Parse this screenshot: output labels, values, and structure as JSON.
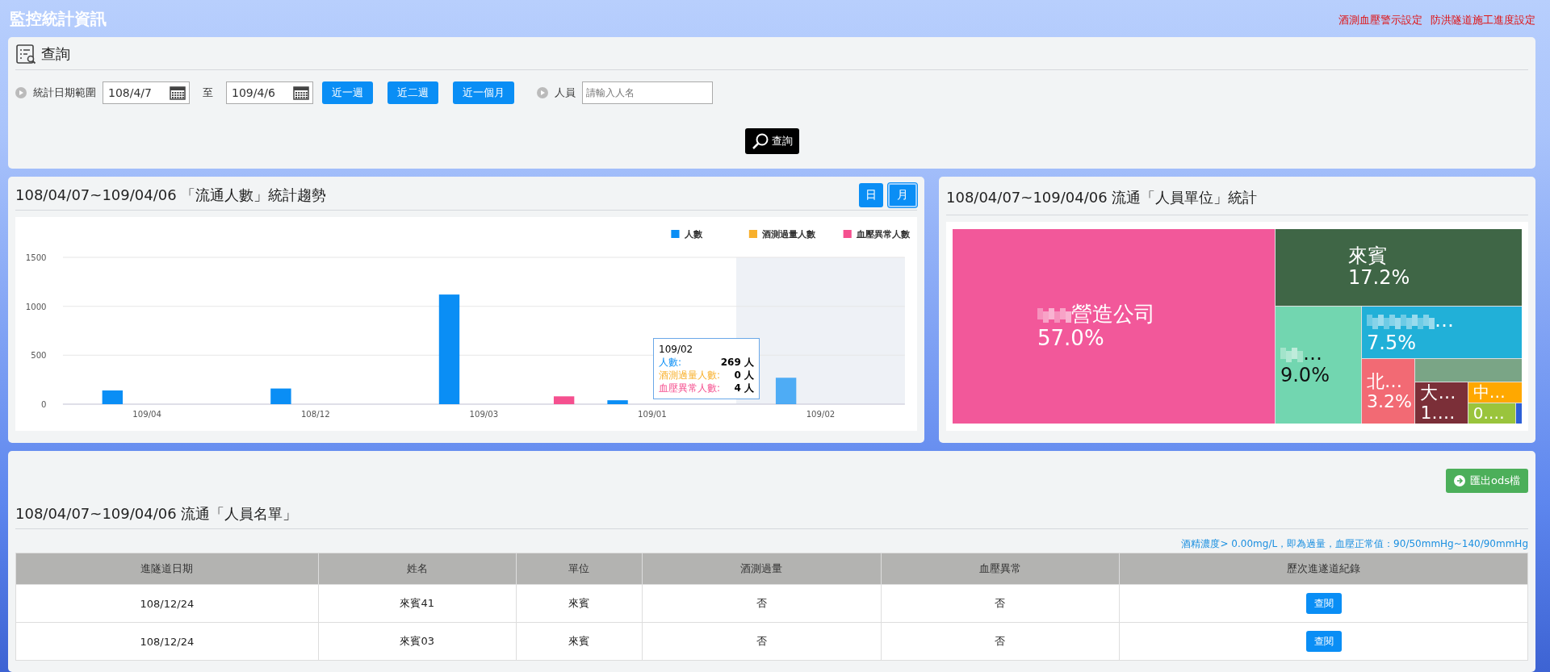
{
  "header": {
    "title": "監控統計資訊",
    "links": [
      "酒測血壓警示設定",
      "防洪隧道施工進度設定"
    ]
  },
  "query": {
    "title": "查詢",
    "date_label": "統計日期範圍",
    "date_from": "108/4/7",
    "to_label": "至",
    "date_to": "109/4/6",
    "quick_buttons": [
      "近一週",
      "近二週",
      "近一個月"
    ],
    "person_label": "人員",
    "person_placeholder": "請輸入人名",
    "submit": "查詢"
  },
  "trend": {
    "title": "108/04/07~109/04/06 「流通人數」統計趨勢",
    "modes": [
      {
        "label": "日",
        "selected": false
      },
      {
        "label": "月",
        "selected": true
      }
    ],
    "chart_data": {
      "type": "bar",
      "legend": "top-right",
      "categories": [
        "109/04",
        "108/12",
        "109/03",
        "109/01",
        "109/02"
      ],
      "ylim": [
        0,
        1500
      ],
      "yticks": [
        0,
        500,
        1000,
        1500
      ],
      "series": [
        {
          "name": "人數",
          "color": "#0a8ef5",
          "values": [
            140,
            160,
            1120,
            40,
            270
          ]
        },
        {
          "name": "酒測過量人數",
          "color": "#f8b02c",
          "values": [
            0,
            0,
            0,
            0,
            0
          ]
        },
        {
          "name": "血壓異常人數",
          "color": "#f5508f",
          "values": [
            0,
            0,
            80,
            0,
            null
          ]
        }
      ]
    },
    "tooltip": {
      "title": "109/02",
      "rows": [
        {
          "label": "人數:",
          "value": "269 人"
        },
        {
          "label": "酒測過量人數:",
          "value": "0 人"
        },
        {
          "label": "血壓異常人數:",
          "value": "4 人"
        }
      ]
    }
  },
  "units": {
    "title": "108/04/07~109/04/06 流通「人員單位」統計",
    "cells": [
      {
        "name": "營造公司",
        "percent": "57.0%",
        "color": "#f2589a",
        "redacted": true,
        "dark": false
      },
      {
        "name": "來賓",
        "percent": "17.2%",
        "color": "#3f6646",
        "redacted": false,
        "dark": false
      },
      {
        "name": "…",
        "percent": "9.0%",
        "color": "#72d6b0",
        "redacted": true,
        "dark": true
      },
      {
        "name": "…",
        "percent": "7.5%",
        "color": "#21b0d8",
        "redacted": true,
        "dark": false
      },
      {
        "name": "北…",
        "percent": "3.2%",
        "color": "#f26a74",
        "redacted": false,
        "dark": false
      },
      {
        "color": "#7aa586"
      },
      {
        "name": "大…",
        "percent": "1.…",
        "color": "#7b2f38",
        "redacted": false,
        "dark": false
      },
      {
        "name": "中…",
        "color": "#ffa800",
        "redacted": false,
        "dark": false
      },
      {
        "percent": "0.…",
        "color": "#9ac43c",
        "dark": false
      },
      {
        "color": "#2d5fd6"
      }
    ]
  },
  "roster": {
    "export": "匯出ods檔",
    "title": "108/04/07~109/04/06 流通「人員名單」",
    "note": "酒精濃度> 0.00mg/L，即為過量，血壓正常值：90/50mmHg~140/90mmHg",
    "columns": [
      "進隧道日期",
      "姓名",
      "單位",
      "酒測過量",
      "血壓異常",
      "歷次進遂道紀錄"
    ],
    "rows": [
      {
        "date": "108/12/24",
        "name": "來賓41",
        "unit": "來賓",
        "alcohol": "否",
        "bp": "否",
        "action": "查閱"
      },
      {
        "date": "108/12/24",
        "name": "來賓03",
        "unit": "來賓",
        "alcohol": "否",
        "bp": "否",
        "action": "查閱"
      }
    ]
  }
}
